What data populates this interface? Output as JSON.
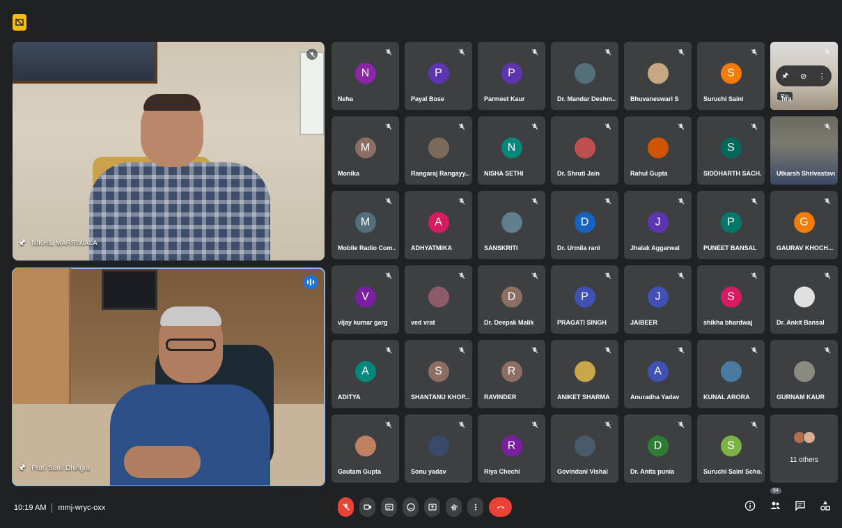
{
  "meeting": {
    "time": "10:19 AM",
    "code": "mmj-wryc-oxx"
  },
  "pinned": [
    {
      "name": "NIKHIL MARRIWALA"
    },
    {
      "name": "Prof. Sunil Dhingra"
    }
  ],
  "participants": [
    {
      "name": "Neha",
      "initial": "N",
      "color": "#8e24aa"
    },
    {
      "name": "Payal Bose",
      "initial": "P",
      "color": "#5e35b1"
    },
    {
      "name": "Parmeet Kaur",
      "initial": "P",
      "color": "#5e35b1"
    },
    {
      "name": "Dr. Mandar Deshm...",
      "initial": "",
      "color": "#546e7a",
      "photo": true
    },
    {
      "name": "Bhuvaneswari S",
      "initial": "",
      "color": "#c8a882",
      "photo": true
    },
    {
      "name": "Suruchi Saini",
      "initial": "S",
      "color": "#f57c00"
    },
    {
      "name": "...hra",
      "initial": "",
      "color": "",
      "video": true,
      "hover": true
    },
    {
      "name": "Monika",
      "initial": "M",
      "color": "#8d6e63"
    },
    {
      "name": "Rangaraj Rangayy...",
      "initial": "",
      "color": "#7a6a5a",
      "photo": true
    },
    {
      "name": "NISHA SETHI",
      "initial": "N",
      "color": "#00897b"
    },
    {
      "name": "Dr. Shruti Jain",
      "initial": "",
      "color": "#c05050",
      "photo": true
    },
    {
      "name": "Rahul Gupta",
      "initial": "",
      "color": "#d35400",
      "photo": true
    },
    {
      "name": "SIDDHARTH SACH...",
      "initial": "S",
      "color": "#00695c"
    },
    {
      "name": "Utkarsh Shrivastava",
      "initial": "",
      "color": "",
      "video": true
    },
    {
      "name": "Mobile Radio Com...",
      "initial": "M",
      "color": "#546e7a"
    },
    {
      "name": "ADHYATMIKA",
      "initial": "A",
      "color": "#d81b60"
    },
    {
      "name": "SANSKRITI",
      "initial": "",
      "color": "#5f7f8f",
      "photo": true
    },
    {
      "name": "Dr. Urmila rani",
      "initial": "D",
      "color": "#1565c0"
    },
    {
      "name": "Jhalak Aggarwal",
      "initial": "J",
      "color": "#5e35b1"
    },
    {
      "name": "PUNEET BANSAL",
      "initial": "P",
      "color": "#00796b"
    },
    {
      "name": "GAURAV KHOCH...",
      "initial": "G",
      "color": "#f57c00"
    },
    {
      "name": "vijay kumar garg",
      "initial": "V",
      "color": "#7b1fa2"
    },
    {
      "name": "ved vrat",
      "initial": "",
      "color": "#8e5a6a",
      "photo": true
    },
    {
      "name": "Dr. Deepak Malik",
      "initial": "D",
      "color": "#8d6e63"
    },
    {
      "name": "PRAGATI SINGH",
      "initial": "P",
      "color": "#3f51b5"
    },
    {
      "name": "JAIBEER",
      "initial": "J",
      "color": "#3f51b5"
    },
    {
      "name": "shikha bhardwaj",
      "initial": "S",
      "color": "#d81b60"
    },
    {
      "name": "Dr. Ankit Bansal",
      "initial": "",
      "color": "#e0e0e0",
      "photo": true
    },
    {
      "name": "ADITYA",
      "initial": "A",
      "color": "#00897b"
    },
    {
      "name": "SHANTANU KHOP...",
      "initial": "S",
      "color": "#8d6e63"
    },
    {
      "name": "RAVINDER",
      "initial": "R",
      "color": "#8d6e63"
    },
    {
      "name": "ANIKET SHARMA",
      "initial": "",
      "color": "#caa64a",
      "photo": true
    },
    {
      "name": "Anuradha Yadav",
      "initial": "A",
      "color": "#3f51b5"
    },
    {
      "name": "KUNAL ARORA",
      "initial": "",
      "color": "#4a7aa0",
      "photo": true
    },
    {
      "name": "GURNAM KAUR",
      "initial": "",
      "color": "#8a8a80",
      "photo": true
    },
    {
      "name": "Gautam Gupta",
      "initial": "",
      "color": "#c08060",
      "photo": true
    },
    {
      "name": "Sonu yadav",
      "initial": "",
      "color": "#3a4a6a",
      "photo": true
    },
    {
      "name": "Riya Chechi",
      "initial": "R",
      "color": "#7b1fa2"
    },
    {
      "name": "Govindani Vishal",
      "initial": "",
      "color": "#4a5a6a",
      "photo": true
    },
    {
      "name": "Dr. Anita punia",
      "initial": "D",
      "color": "#2e7d32"
    },
    {
      "name": "Suruchi Saini Scho...",
      "initial": "S",
      "color": "#7cb342"
    },
    {
      "name": "11 others",
      "others": true
    }
  ],
  "tooltip": "Pin",
  "people_count": "54"
}
